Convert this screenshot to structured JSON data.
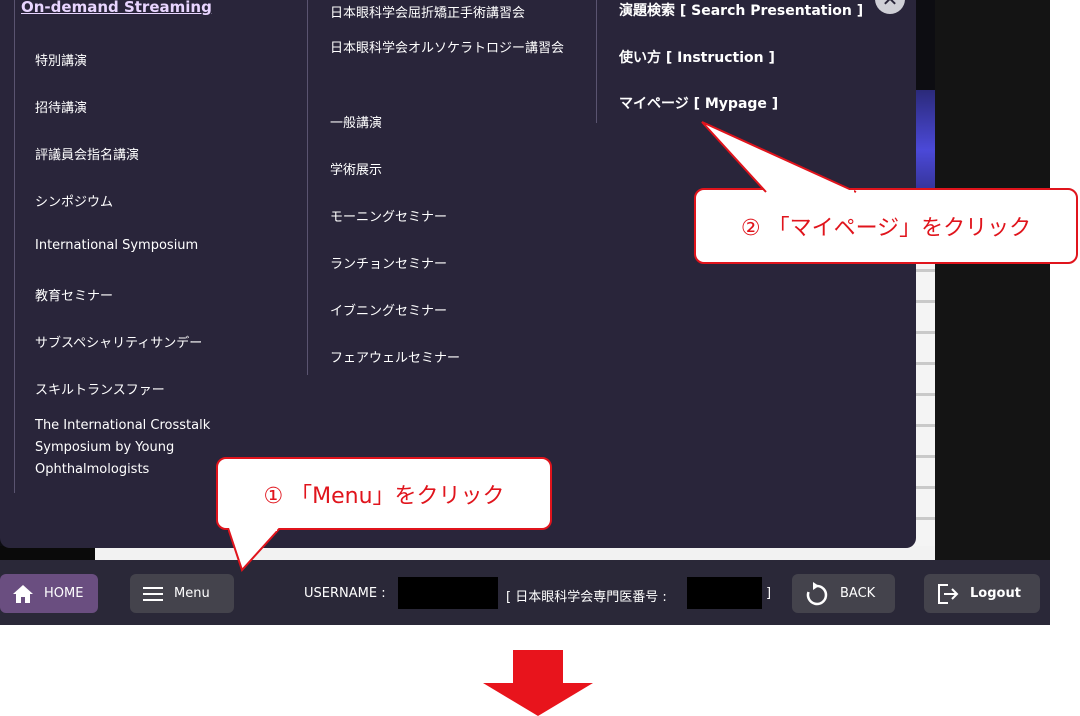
{
  "menu": {
    "col1_heading": "On-demand Streaming",
    "col1_items": [
      "特別講演",
      "招待講演",
      "評議員会指名講演",
      "シンポジウム",
      "International Symposium",
      "教育セミナー",
      "サブスペシャリティサンデー",
      "スキルトランスファー",
      "The International Crosstalk Symposium by Young Ophthalmologists"
    ],
    "col2_items": [
      "日本眼科学会屈折矯正手術講習会",
      "日本眼科学会オルソケラトロジー講習会",
      "一般講演",
      "学術展示",
      "モーニングセミナー",
      "ランチョンセミナー",
      "イブニングセミナー",
      "フェアウェルセミナー"
    ],
    "col3_items": [
      "演題検索 [ Search Presentation ]",
      "使い方 [ Instruction ]",
      "マイページ [ Mypage ]"
    ],
    "close_icon": "close-icon"
  },
  "bottom_bar": {
    "home_label": "HOME",
    "menu_label": "Menu",
    "username_label": "USERNAME :",
    "member_label": "[ 日本眼科学会専門医番号 :",
    "member_close": "]",
    "back_label": "BACK",
    "logout_label": "Logout"
  },
  "annotations": {
    "callout_menu": "① 「Menu」をクリック",
    "callout_mypage": "② 「マイページ」をクリック"
  },
  "colors": {
    "panel": "#29253a",
    "heading_link": "#e8d5ff",
    "callout_red": "#e0141c",
    "home_button": "#6a4e80"
  }
}
